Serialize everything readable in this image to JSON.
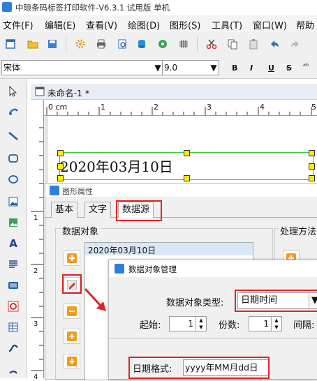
{
  "window": {
    "title": "中琅条码标签打印软件-V6.3.1 试用版 单机"
  },
  "menu": [
    "文件(F)",
    "编辑(E)",
    "查看(V)",
    "绘图(D)",
    "图形(S)",
    "工具(T)",
    "窗口(W)",
    "帮助"
  ],
  "fontbar": {
    "font_name": "宋体",
    "font_size": "9.0",
    "bold": "B",
    "italic": "I",
    "underline": "U",
    "strike": "S"
  },
  "document": {
    "tab_title": "未命名-1 *"
  },
  "ruler": {
    "unit_label": "0 cm",
    "ticks": [
      "1",
      "2",
      "3",
      "4",
      "5"
    ],
    "vertical_ticks": [
      "1",
      "2",
      "3",
      "4"
    ]
  },
  "canvas": {
    "label_text": "2020年03月10日"
  },
  "properties_dialog": {
    "title": "图形属性",
    "tabs": [
      "基本",
      "文字",
      "数据源"
    ],
    "active_tab": "数据源",
    "data_objects_label": "数据对象",
    "data_objects": [
      "2020年03月10日"
    ],
    "processing_label": "处理方法"
  },
  "mgmt_dialog": {
    "title": "数据对象管理",
    "type_label": "数据对象类型:",
    "type_value": "日期时间",
    "start_label": "起始:",
    "start_value": "1",
    "copies_label": "份数:",
    "copies_value": "1",
    "interval_label": "间隔:",
    "date_format_label": "日期格式:",
    "date_format_value": "yyyy年MM月dd日"
  },
  "colors": {
    "highlight": "#e02424",
    "selection": "#2ecc40",
    "handle": "#ffeb00"
  }
}
